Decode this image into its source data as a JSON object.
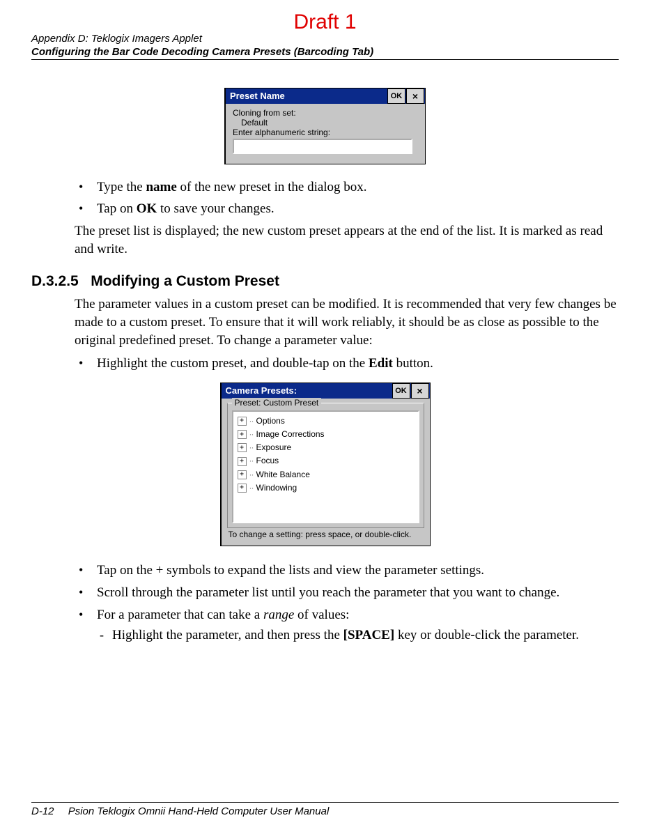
{
  "watermark": "Draft 1",
  "header": {
    "appendix": "Appendix D:  Teklogix Imagers Applet",
    "subtitle": "Configuring the Bar Code Decoding Camera Presets (Barcoding Tab)"
  },
  "dialog1": {
    "title": "Preset Name",
    "ok": "OK",
    "close_glyph": "×",
    "line1": "Cloning from set:",
    "line2": "Default",
    "prompt": "Enter alphanumeric string:",
    "value": ""
  },
  "bullets1": [
    {
      "pre": "Type the ",
      "bold": "name",
      "post": " of the new preset in the dialog box."
    },
    {
      "pre": "Tap on ",
      "bold": "OK",
      "post": " to save your changes."
    }
  ],
  "para1": "The preset list is displayed; the new custom preset appears at the end of the list. It is marked as read and write.",
  "section": {
    "num": "D.3.2.5",
    "title": "Modifying a Custom Preset"
  },
  "para2": "The parameter values in a custom preset can be modified. It is recommended that very few changes be made to a custom preset. To ensure that it will work reliably, it should be as close as possible to the original predefined preset. To change a parameter value:",
  "bullets2": [
    {
      "pre": "Highlight the custom preset, and double-tap on the ",
      "bold": "Edit",
      "post": " button."
    }
  ],
  "dialog2": {
    "title": "Camera Presets:",
    "ok": "OK",
    "close_glyph": "×",
    "group_label": "Preset: Custom Preset",
    "items": [
      "Options",
      "Image Corrections",
      "Exposure",
      "Focus",
      "White Balance",
      "Windowing"
    ],
    "hint": "To change a setting: press space, or double-click."
  },
  "bullets3": [
    {
      "plain": "Tap on the + symbols to expand the lists and view the parameter settings."
    },
    {
      "plain": "Scroll through the parameter list until you reach the parameter that you want to change."
    },
    {
      "pre": "For a parameter that can take a ",
      "ital": "range",
      "post": " of values:",
      "sub": [
        {
          "pre": "Highlight the parameter, and then press the ",
          "bold": "[SPACE]",
          "post": " key or double-click the parameter."
        }
      ]
    }
  ],
  "footer": {
    "page": "D-12",
    "title": "Psion Teklogix Omnii Hand-Held Computer User Manual"
  }
}
